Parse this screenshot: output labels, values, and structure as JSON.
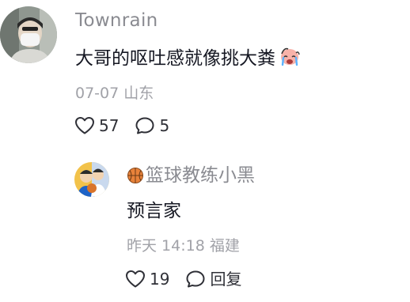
{
  "main_comment": {
    "username": "Townrain",
    "text": "大哥的呕吐感就像挑大粪",
    "emoji_icon": "crying-face-emoji-icon",
    "date": "07-07",
    "location": "山东",
    "like_count": "57",
    "reply_count": "5"
  },
  "reply_comment": {
    "username_badge_icon": "basketball-icon",
    "username": "篮球教练小黑",
    "text": "预言家",
    "date": "昨天 14:18",
    "location": "福建",
    "like_count": "19",
    "reply_label": "回复"
  },
  "colors": {
    "username": "#8a8b91",
    "meta": "#a1a2a8",
    "text": "#161823",
    "icon": "#2f3037"
  }
}
